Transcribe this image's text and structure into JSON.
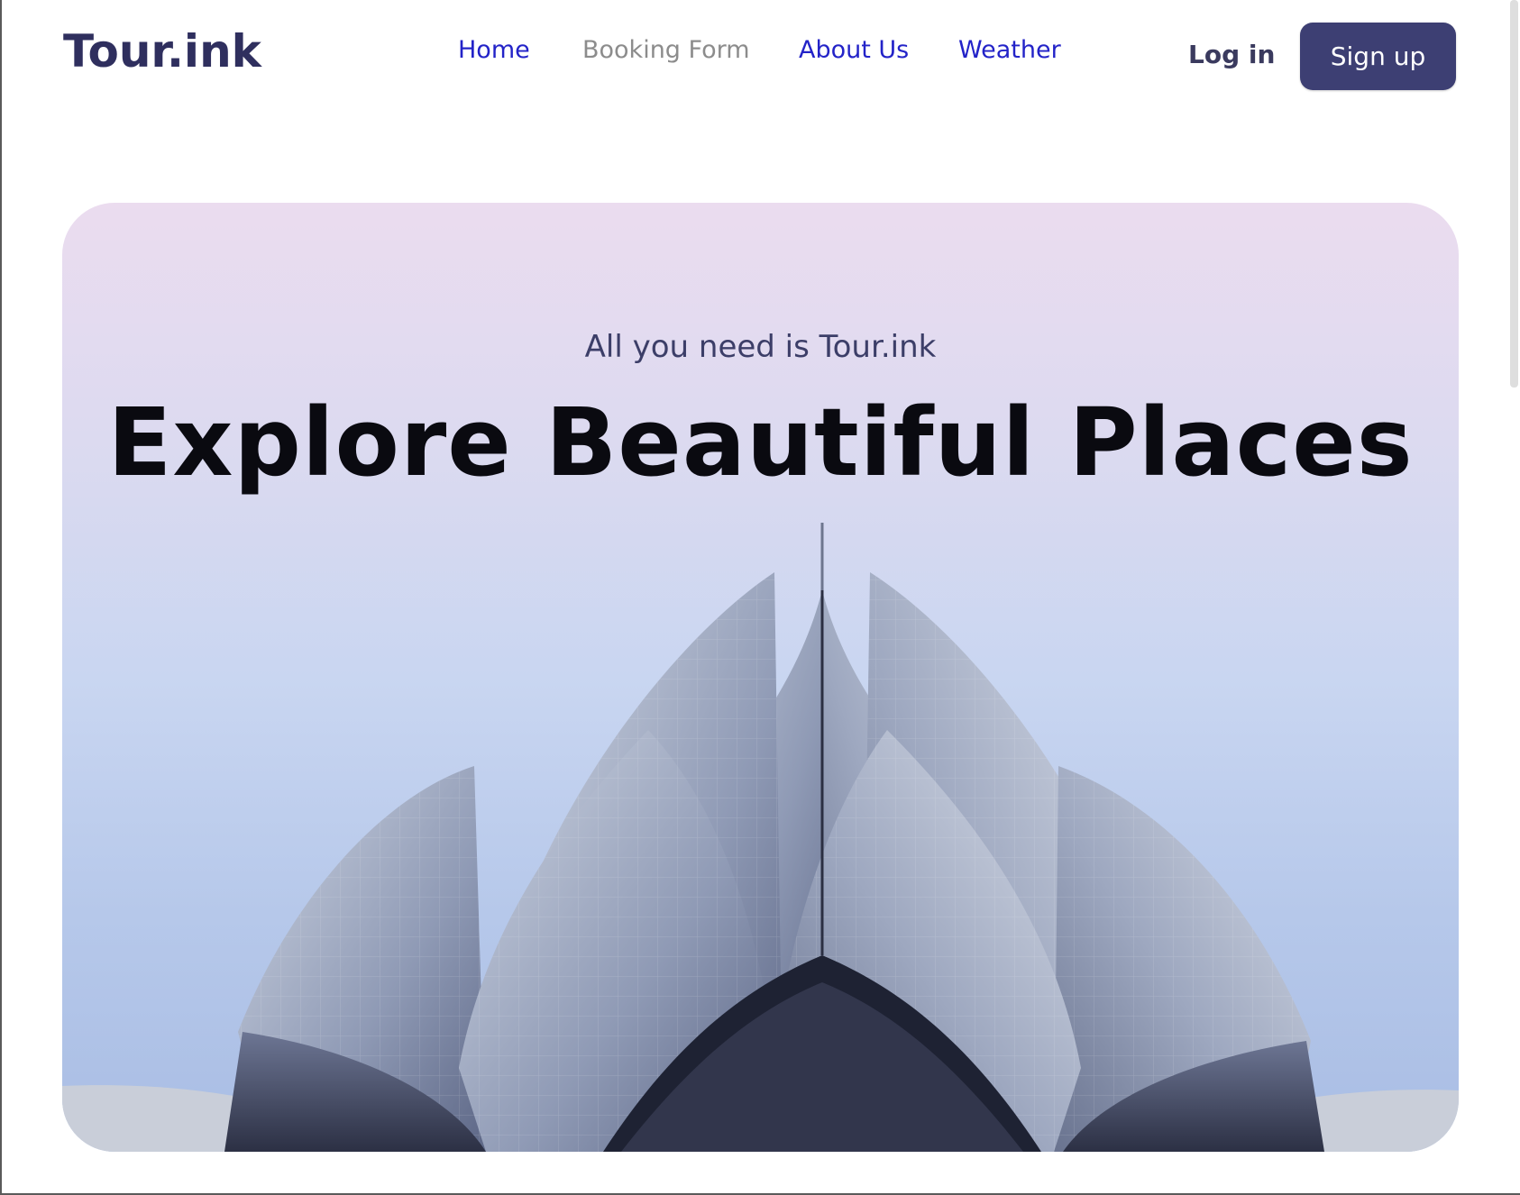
{
  "brand": {
    "logo": "Tour.ink"
  },
  "nav": {
    "items": [
      {
        "label": "Home"
      },
      {
        "label": "Booking Form"
      },
      {
        "label": "About Us"
      },
      {
        "label": "Weather"
      }
    ]
  },
  "auth": {
    "login_label": "Log in",
    "signup_label": "Sign up"
  },
  "hero": {
    "subtitle": "All you need is Tour.ink",
    "title": "Explore Beautiful Places",
    "image_name": "lotus-temple-image"
  },
  "colors": {
    "brand_navy": "#3d3f73",
    "nav_link": "#2323c8",
    "nav_link_muted": "#8c8c8c"
  }
}
